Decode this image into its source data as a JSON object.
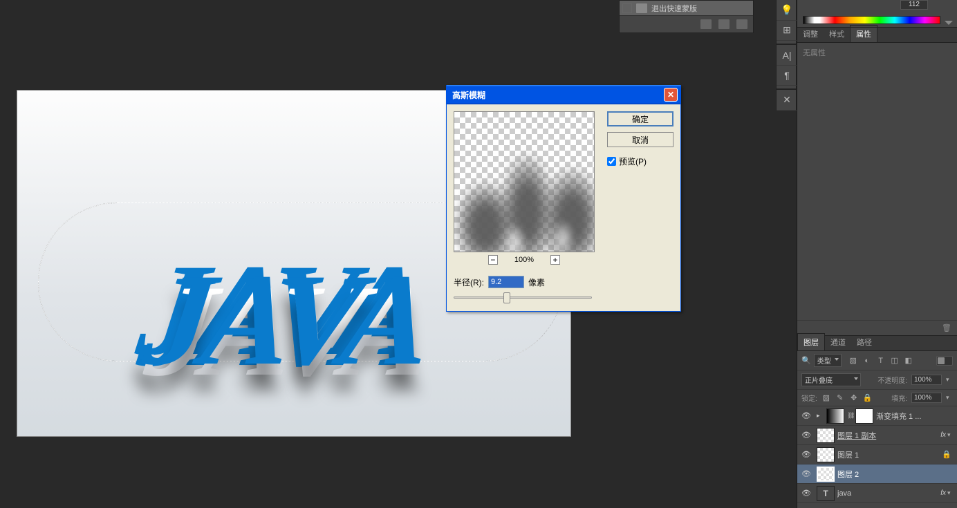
{
  "quickmask": {
    "label": "退出快速蒙版"
  },
  "colorbar": {
    "value": "112"
  },
  "toolstrip": {
    "i1": "💡",
    "i2": "⊞",
    "i3": "A|",
    "i4": "¶",
    "i5": "✕"
  },
  "props_panel": {
    "tabs": [
      "调整",
      "样式",
      "属性"
    ],
    "active": 2,
    "empty_text": "无属性"
  },
  "layers_panel": {
    "tabs": [
      "图层",
      "通道",
      "路径"
    ],
    "active": 0,
    "kind_label": "类型",
    "blend_mode": "正片叠底",
    "opacity_label": "不透明度:",
    "opacity_value": "100%",
    "lock_label": "锁定:",
    "fill_label": "填充:",
    "fill_value": "100%",
    "layers": [
      {
        "name": "渐变填充 1 ...",
        "type": "gradient",
        "fx": false,
        "locked": false
      },
      {
        "name": "图层 1 副本",
        "type": "raster",
        "fx": true,
        "locked": false,
        "underline": true
      },
      {
        "name": "图层 1",
        "type": "raster",
        "fx": false,
        "locked": true
      },
      {
        "name": "图层 2",
        "type": "raster",
        "fx": false,
        "locked": false,
        "selected": true
      },
      {
        "name": "java",
        "type": "text",
        "fx": true,
        "locked": false
      }
    ]
  },
  "dialog": {
    "title": "高斯模糊",
    "ok": "确定",
    "cancel": "取消",
    "preview_label": "预览(P)",
    "zoom": "100%",
    "radius_label": "半径(R):",
    "radius_value": "9.2",
    "radius_unit": "像素"
  },
  "canvas": {
    "text": "JAVA"
  }
}
